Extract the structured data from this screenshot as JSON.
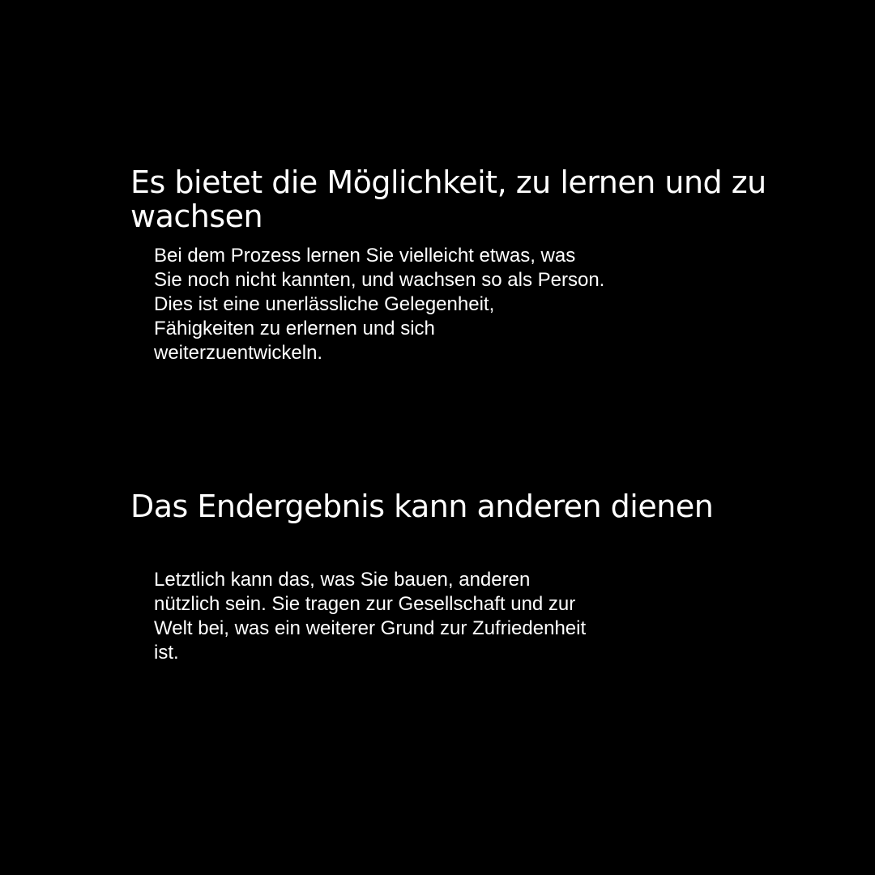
{
  "sections": [
    {
      "title": "Es bietet die Möglichkeit, zu lernen und zu wachsen",
      "body_lines": [
        "Bei dem Prozess lernen Sie vielleicht etwas, was",
        "Sie noch nicht kannten, und wachsen so als Person.",
        "Dies ist eine unerlässliche Gelegenheit,",
        "Fähigkeiten zu erlernen und sich",
        "weiterzuentwickeln."
      ]
    },
    {
      "title": "Das Endergebnis kann anderen dienen",
      "body_lines": [
        "Letztlich kann das, was Sie bauen, anderen",
        "nützlich sein. Sie tragen zur Gesellschaft und zur",
        "Welt bei, was ein weiterer Grund zur Zufriedenheit",
        "ist."
      ]
    }
  ],
  "colors": {
    "background": "#000000",
    "text": "#ffffff"
  }
}
